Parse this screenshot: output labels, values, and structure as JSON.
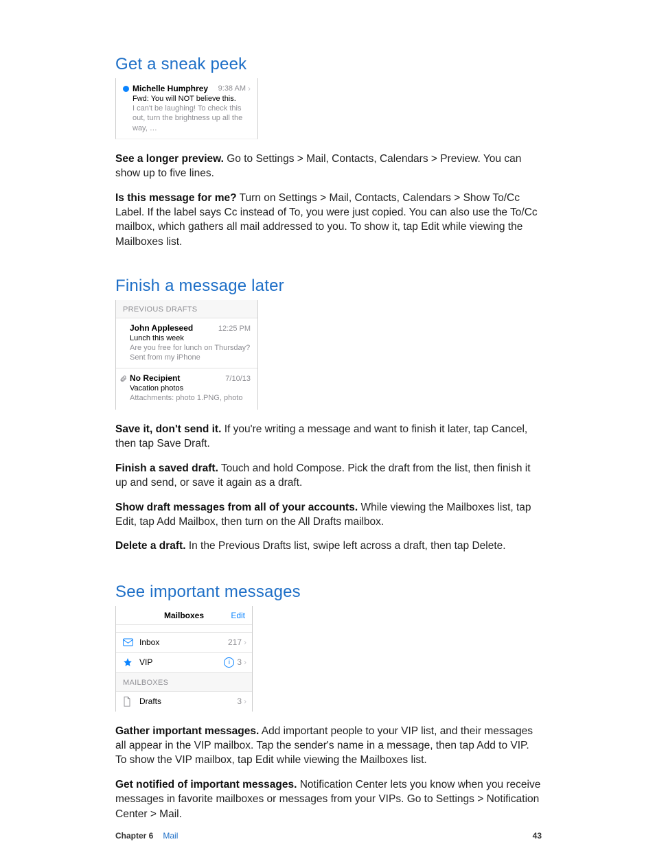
{
  "section1": {
    "heading": "Get a sneak peek",
    "preview_card": {
      "sender": "Michelle Humphrey",
      "time": "9:38 AM",
      "chevron": "›",
      "subject": "Fwd: You will NOT believe this.",
      "preview": "I can't be laughing! To check this out, turn the brightness up all the way, …"
    },
    "p1_bold": "See a longer preview.",
    "p1_rest": " Go to Settings > Mail, Contacts, Calendars > Preview. You can show up to five lines.",
    "p2_bold": "Is this message for me?",
    "p2_rest": " Turn on Settings > Mail, Contacts, Calendars > Show To/Cc Label. If the label says Cc instead of To, you were just copied. You can also use the To/Cc mailbox, which gathers all mail addressed to you. To show it, tap Edit while viewing the Mailboxes list."
  },
  "section2": {
    "heading": "Finish a message later",
    "drafts_header": "PREVIOUS DRAFTS",
    "drafts": [
      {
        "from": "John Appleseed",
        "time": "12:25 PM",
        "subject": "Lunch this week",
        "preview": "Are you free for lunch on Thursday? Sent from my iPhone",
        "has_attachment": false
      },
      {
        "from": "No Recipient",
        "time": "7/10/13",
        "subject": "Vacation photos",
        "preview": "Attachments: photo 1.PNG, photo",
        "has_attachment": true
      }
    ],
    "p1_bold": "Save it, don't send it.",
    "p1_rest": " If you're writing a message and want to finish it later, tap Cancel, then tap Save Draft.",
    "p2_bold": "Finish a saved draft.",
    "p2_rest": " Touch and hold Compose. Pick the draft from the list, then finish it up and send, or save it again as a draft.",
    "p3_bold": "Show draft messages from all of your accounts.",
    "p3_rest": "  While viewing the Mailboxes list, tap Edit, tap Add Mailbox, then turn on the All Drafts mailbox.",
    "p4_bold": "Delete a draft.",
    "p4_rest": " In the Previous Drafts list, swipe left across a draft, then tap Delete."
  },
  "section3": {
    "heading": "See important messages",
    "mailboxes": {
      "title": "Mailboxes",
      "edit": "Edit",
      "smart": [
        {
          "icon": "inbox",
          "label": "Inbox",
          "count": "217",
          "info": false
        },
        {
          "icon": "star",
          "label": "VIP",
          "count": "3",
          "info": true
        }
      ],
      "accounts_header": "MAILBOXES",
      "accounts": [
        {
          "icon": "draft",
          "label": "Drafts",
          "count": "3"
        }
      ],
      "chevron": "›",
      "info_glyph": "i"
    },
    "p1_bold": "Gather important messages.",
    "p1_rest": " Add important people to your VIP list, and their messages all appear in the VIP mailbox. Tap the sender's name in a message, then tap Add to VIP. To show the VIP mailbox, tap Edit while viewing the Mailboxes list.",
    "p2_bold": "Get notified of important messages.",
    "p2_rest": " Notification Center lets you know when you receive messages in favorite mailboxes or messages from your VIPs. Go to Settings > Notification Center > Mail."
  },
  "footer": {
    "chapter": "Chapter  6",
    "title": "Mail",
    "page": "43"
  }
}
